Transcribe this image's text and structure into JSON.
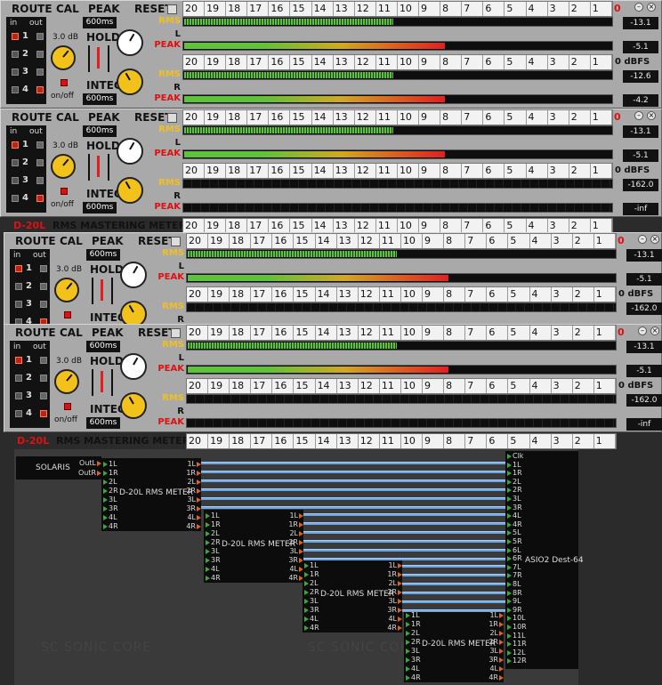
{
  "labels": {
    "route": "ROUTE",
    "cal": "CAL",
    "peak": "PEAK",
    "reset": "RESET",
    "in": "in",
    "out": "out",
    "hold": "HOLD",
    "integ": "INTEG",
    "cal_db": "3.0 dB",
    "onoff": "on/off",
    "dbfs": "0 dBFS"
  },
  "route_numbers": [
    "1",
    "2",
    "3",
    "4"
  ],
  "scale": [
    "20",
    "19",
    "18",
    "17",
    "16",
    "15",
    "14",
    "13",
    "12",
    "11",
    "10",
    "9",
    "8",
    "7",
    "6",
    "5",
    "4",
    "3",
    "2",
    "1"
  ],
  "scale_zero": "0",
  "rows": {
    "rms": "RMS",
    "l": "L",
    "r": "R",
    "peak": "PEAK"
  },
  "footer": {
    "name": "D-20L",
    "subtitle": "RMS  MASTERING  METER"
  },
  "panels": [
    {
      "hold": "600ms",
      "integ": "600ms",
      "vals": [
        "-13.1",
        "-5.1",
        "-12.6",
        "-4.2"
      ]
    },
    {
      "hold": "600ms",
      "integ": "600ms",
      "vals": [
        "-13.1",
        "-5.1",
        "-162.0",
        "-inf"
      ]
    },
    {
      "hold": "600ms",
      "integ": "600ms",
      "vals": [
        "-13.1",
        "-5.1",
        "-162.0",
        "-inf"
      ]
    },
    {
      "hold": "600ms",
      "integ": "600ms",
      "vals": [
        "-13.1",
        "-5.1",
        "-162.0",
        "-inf"
      ]
    }
  ],
  "levels": {
    "rms": 0.49,
    "peak": 0.61
  },
  "patch": {
    "solaris": "SOLARIS",
    "outL": "OutL",
    "outR": "OutR",
    "meter": "D-20L RMS METER",
    "asio": "ASIO2 Dest-64",
    "clk": "Clk",
    "ports8": [
      "1L",
      "1R",
      "2L",
      "2R",
      "3L",
      "3R",
      "4L",
      "4R"
    ],
    "asio_ports": [
      "Clk",
      "1L",
      "1R",
      "2L",
      "2R",
      "3L",
      "3R",
      "4L",
      "4R",
      "5L",
      "5R",
      "6L",
      "6R",
      "7L",
      "7R",
      "8L",
      "8R",
      "9L",
      "9R",
      "10L",
      "10R",
      "11L",
      "11R",
      "12L",
      "12R"
    ],
    "watermark": "SC  SONIC CORE"
  },
  "colors": {
    "rms": "#f0c020",
    "peak": "#e01010",
    "meter_green": "#5ec23a"
  }
}
